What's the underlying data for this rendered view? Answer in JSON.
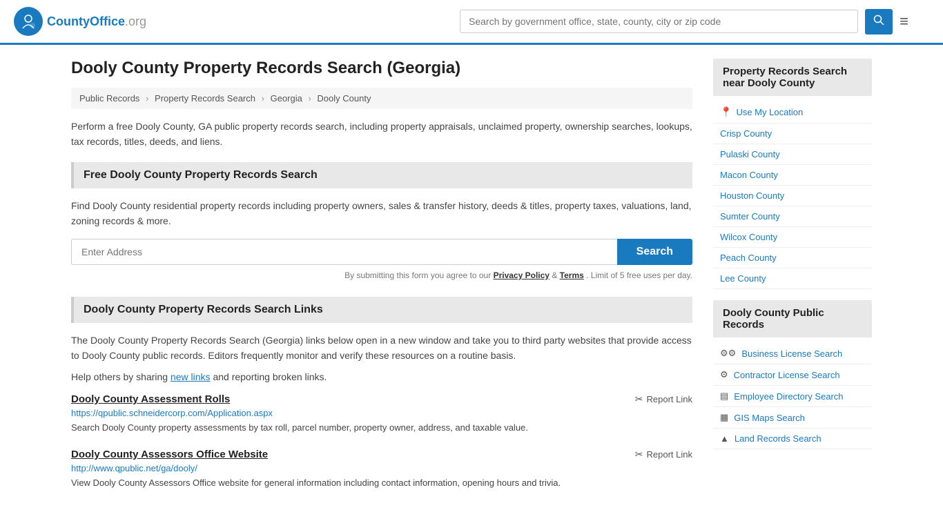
{
  "header": {
    "logo_text": "CountyOffice",
    "logo_tld": ".org",
    "search_placeholder": "Search by government office, state, county, city or zip code",
    "hamburger_label": "≡"
  },
  "page": {
    "title": "Dooly County Property Records Search (Georgia)",
    "breadcrumb": [
      {
        "label": "Public Records",
        "url": "#"
      },
      {
        "label": "Property Records Search",
        "url": "#"
      },
      {
        "label": "Georgia",
        "url": "#"
      },
      {
        "label": "Dooly County",
        "url": "#"
      }
    ],
    "description": "Perform a free Dooly County, GA public property records search, including property appraisals, unclaimed property, ownership searches, lookups, tax records, titles, deeds, and liens."
  },
  "search_section": {
    "header": "Free Dooly County Property Records Search",
    "desc": "Find Dooly County residential property records including property owners, sales & transfer history, deeds & titles, property taxes, valuations, land, zoning records & more.",
    "address_placeholder": "Enter Address",
    "search_button": "Search",
    "terms_text": "By submitting this form you agree to our",
    "privacy_label": "Privacy Policy",
    "and_text": "&",
    "terms_label": "Terms",
    "limit_text": ". Limit of 5 free uses per day."
  },
  "links_section": {
    "header": "Dooly County Property Records Search Links",
    "desc": "The Dooly County Property Records Search (Georgia) links below open in a new window and take you to third party websites that provide access to Dooly County public records. Editors frequently monitor and verify these resources on a routine basis.",
    "share_text": "Help others by sharing",
    "new_links_label": "new links",
    "share_text2": "and reporting broken links.",
    "links": [
      {
        "title": "Dooly County Assessment Rolls",
        "url": "https://qpublic.schneidercorp.com/Application.aspx",
        "desc": "Search Dooly County property assessments by tax roll, parcel number, property owner, address, and taxable value.",
        "report_label": "Report Link"
      },
      {
        "title": "Dooly County Assessors Office Website",
        "url": "http://www.qpublic.net/ga/dooly/",
        "desc": "View Dooly County Assessors Office website for general information including contact information, opening hours and trivia.",
        "report_label": "Report Link"
      }
    ]
  },
  "sidebar": {
    "nearby_header": "Property Records Search near Dooly County",
    "use_my_location": "Use My Location",
    "nearby_counties": [
      {
        "label": "Crisp County"
      },
      {
        "label": "Pulaski County"
      },
      {
        "label": "Macon County"
      },
      {
        "label": "Houston County"
      },
      {
        "label": "Sumter County"
      },
      {
        "label": "Wilcox County"
      },
      {
        "label": "Peach County"
      },
      {
        "label": "Lee County"
      }
    ],
    "public_records_header": "Dooly County Public Records",
    "public_records": [
      {
        "icon": "⚙⚙",
        "label": "Business License Search"
      },
      {
        "icon": "⚙",
        "label": "Contractor License Search"
      },
      {
        "icon": "▤",
        "label": "Employee Directory Search"
      },
      {
        "icon": "▦",
        "label": "GIS Maps Search"
      },
      {
        "icon": "▲",
        "label": "Land Records Search"
      }
    ]
  }
}
